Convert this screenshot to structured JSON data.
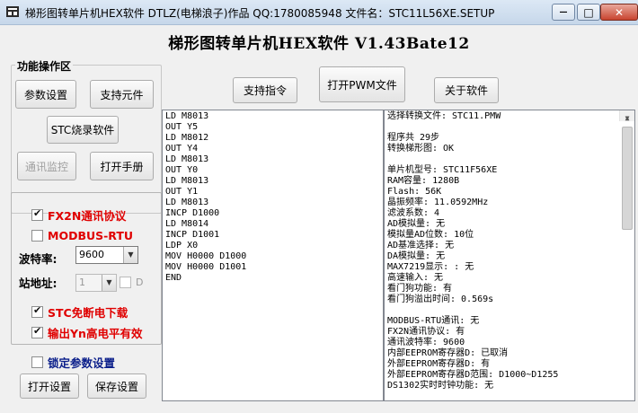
{
  "window": {
    "title": "梯形图转单片机HEX软件 DTLZ(电梯浪子)作品 QQ:1780085948 文件名：STC11L56XE.SETUP",
    "minimize": "—",
    "maximize": "□",
    "close": "✕"
  },
  "heading": "梯形图转单片机HEX软件 V1.43Bate12",
  "top_buttons": {
    "support_instructions": "支持指令",
    "open_pwm_file": "打开PWM文件",
    "about": "关于软件"
  },
  "func_group": {
    "title": "功能操作区",
    "param_settings": "参数设置",
    "support_components": "支持元件",
    "stc_burn": "STC烧录软件",
    "comm_monitor": "通讯监控",
    "open_manual": "打开手册"
  },
  "settings": {
    "fx2n": "FX2N通讯协议",
    "modbus": "MODBUS-RTU",
    "baud_label": "波特率:",
    "baud_value": "9600",
    "station_label": "站地址:",
    "station_value": "1",
    "station_extra": "D",
    "stc_power_down": "STC免断电下载",
    "yn_output": "输出Yn高电平有效",
    "lock_params": "锁定参数设置",
    "open_settings": "打开设置",
    "save_settings": "保存设置",
    "fx2n_checked": true,
    "modbus_checked": false,
    "station_chk_checked": false,
    "stc_power_down_checked": true,
    "yn_output_checked": true,
    "lock_params_checked": false
  },
  "ladder_code": [
    "LD M8013",
    "OUT Y5",
    "LD M8012",
    "OUT Y4",
    "LD M8013",
    "OUT Y0",
    "LD M8013",
    "OUT Y1",
    "LD M8013",
    "INCP D1000",
    "LD M8014",
    "INCP D1001",
    "LDP X0",
    "MOV H0000 D1000",
    "MOV H0000 D1001",
    "END"
  ],
  "info_lines": [
    "选择转换文件: STC11.PMW",
    "",
    "程序共 29步",
    "转换梯形图: OK",
    "",
    "单片机型号: STC11F56XE",
    "RAM容量: 1280B",
    "Flash: 56K",
    "晶振频率: 11.0592MHz",
    "滤波系数: 4",
    "AD模拟量: 无",
    "模拟量AD位数: 10位",
    "AD基准选择: 无",
    "DA模拟量: 无",
    "MAX7219显示: : 无",
    "高速输入: 无",
    "看门狗功能: 有",
    "看门狗溢出时间: 0.569s",
    "",
    "MODBUS-RTU通讯: 无",
    "FX2N通讯协议: 有",
    "通讯波特率: 9600",
    "内部EEPROM寄存器D: 已取消",
    "外部EEPROM寄存器D: 有",
    "外部EEPROM寄存器D范围: D1000~D1255",
    "DS1302实时时钟功能: 无"
  ]
}
